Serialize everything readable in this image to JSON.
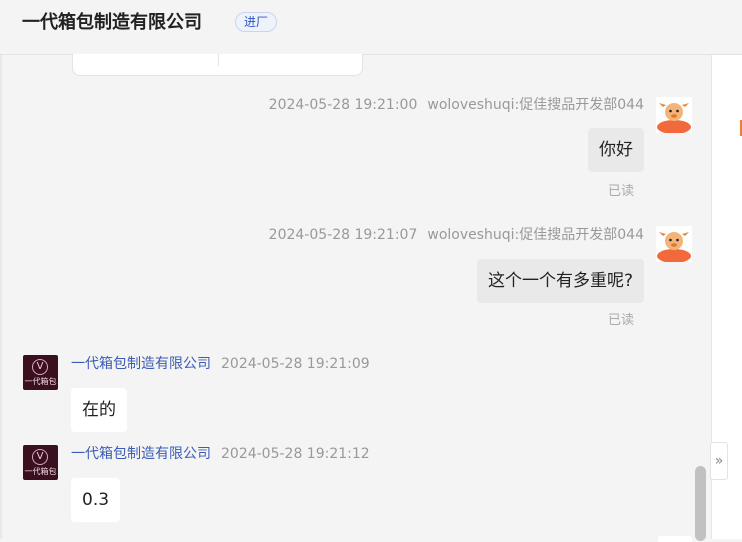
{
  "header": {
    "title": "一代箱包制造有限公司",
    "badge": "进厂"
  },
  "messages": [
    {
      "timestamp": "2024-05-28 19:21:00",
      "sender": "woloveshuqi:促佳搜品开发部044",
      "text": "你好",
      "status": "已读"
    },
    {
      "timestamp": "2024-05-28 19:21:07",
      "sender": "woloveshuqi:促佳搜品开发部044",
      "text": "这个一个有多重呢?",
      "status": "已读"
    },
    {
      "sender": "一代箱包制造有限公司",
      "timestamp": "2024-05-28 19:21:09",
      "text": "在的"
    },
    {
      "sender": "一代箱包制造有限公司",
      "timestamp": "2024-05-28 19:21:12",
      "text": "0.3"
    }
  ],
  "company_avatar_label": "一代箱包",
  "expand_icon": "»",
  "colors": {
    "sender_name": "#3b5bb5",
    "self_bubble": "#e9e9e9",
    "background": "#f4f4f4",
    "badge_text": "#2f55c4",
    "accent": "#f07a3a"
  }
}
